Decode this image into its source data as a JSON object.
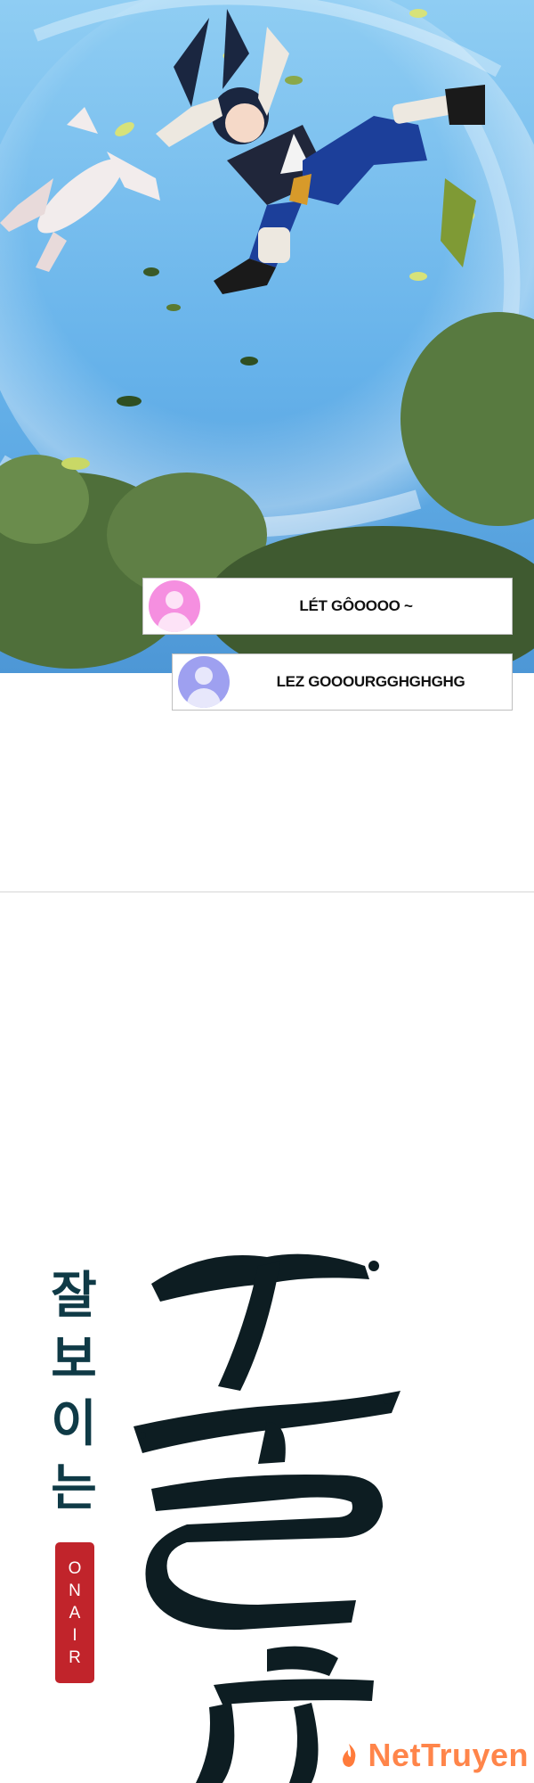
{
  "comments": [
    {
      "text": "LÉT GÔOOOO ~",
      "avatar_color": "#f58fe0"
    },
    {
      "text": "LEZ GOOOURGGHGHGHG",
      "avatar_color": "#9ea0f0"
    }
  ],
  "title": {
    "korean_chars": [
      "잘",
      "보",
      "이",
      "는"
    ],
    "onair_letters": [
      "O",
      "N",
      "A",
      "I",
      "R"
    ],
    "colors": {
      "title": "#0f3a46",
      "badge": "#c1242b",
      "brush": "#0d1d22"
    }
  },
  "watermark": {
    "text": "NetTruyen",
    "color": "#ff7b3b"
  },
  "art": {
    "sky_top": "#7fc4f0",
    "sky_bottom": "#5aa6e3",
    "foliage": "#4e6e3a",
    "pants": "#1c3f9a"
  }
}
